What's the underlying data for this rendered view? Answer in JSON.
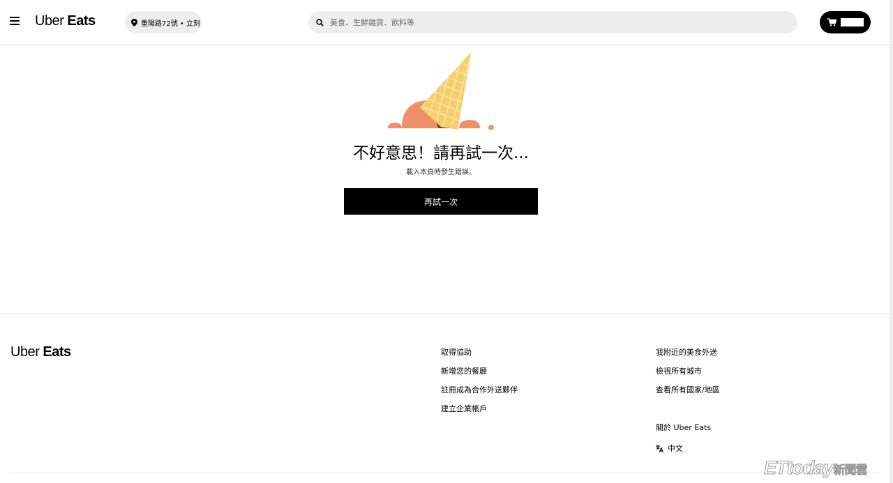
{
  "header": {
    "logo": {
      "uber": "Uber",
      "eats": "Eats"
    },
    "address": "重陽路72號 • 立刻",
    "search_placeholder": "美食、生鮮雜貨、飲料等",
    "menu_icon": "hamburger-menu-icon",
    "location_icon": "location-pin-icon",
    "search_icon": "search-icon",
    "cart_icon": "cart-icon"
  },
  "error": {
    "illustration": "dropped-ice-cream-cone",
    "title": "不好意思！請再試一次...",
    "subtitle": "載入本頁時發生錯誤。",
    "retry_label": "再試一次"
  },
  "footer": {
    "logo": {
      "uber": "Uber",
      "eats": "Eats"
    },
    "col1": [
      "取得協助",
      "新增您的餐廳",
      "註冊成為合作外送夥伴",
      "建立企業帳戶"
    ],
    "col2": [
      "我附近的美食外送",
      "檢視所有城市",
      "查看所有國家/地區"
    ],
    "about": "關於 Uber Eats",
    "language": "中文",
    "language_icon": "translate-icon"
  },
  "watermark": {
    "latin": "ETtoday",
    "cn": "新聞雲"
  },
  "colors": {
    "cone": "#f6cf6c",
    "ice_cream": "#f0906a",
    "ice_cream_shadow": "#8a3a1e",
    "pill_bg": "#eeeeee",
    "button_bg": "#000000"
  }
}
